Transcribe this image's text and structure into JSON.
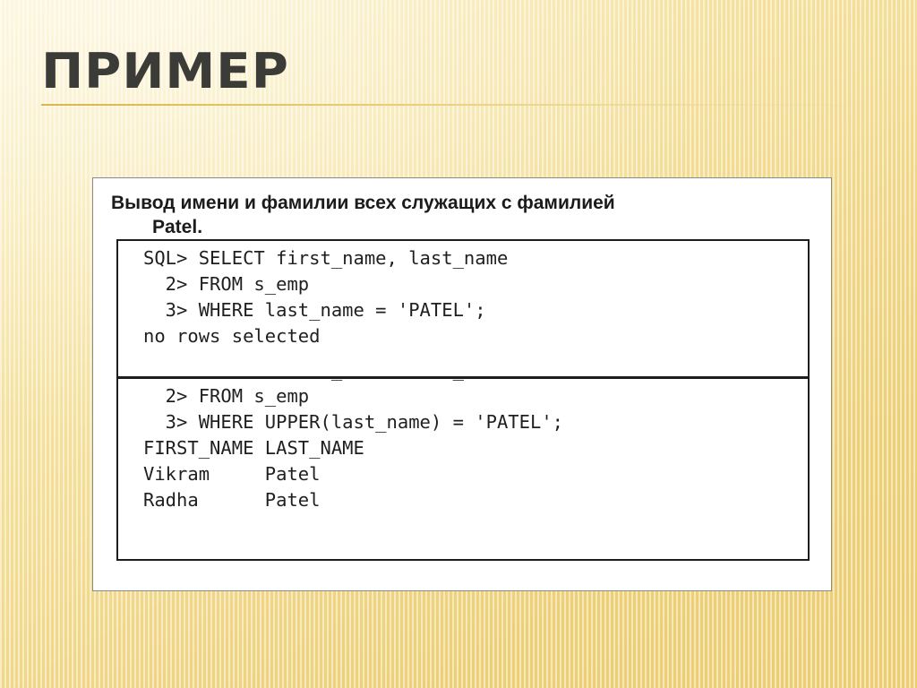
{
  "slide": {
    "title": "ПРИМЕР",
    "lead_line1": "Вывод имени и фамилии всех служащих с фамилией",
    "lead_line2": "Patel.",
    "code_block_1": "SQL> SELECT first_name, last_name\n  2> FROM s_emp\n  3> WHERE last_name = 'PATEL';\nno rows selected",
    "code_block_2": "SQL> SELECT first_name, last_name\n  2> FROM s_emp\n  3> WHERE UPPER(last_name) = 'PATEL';\nFIRST_NAME LAST_NAME\nVikram     Patel\nRadha      Patel"
  },
  "colors": {
    "background_light": "#fbf0c8",
    "background_dark": "#eccd70",
    "title_text": "#3b3b38",
    "rule": "#d8b84a",
    "content_background": "#ffffff",
    "content_border": "#8a8a8a",
    "code_border": "#1d1d1d",
    "body_text": "#1b1b1b"
  }
}
